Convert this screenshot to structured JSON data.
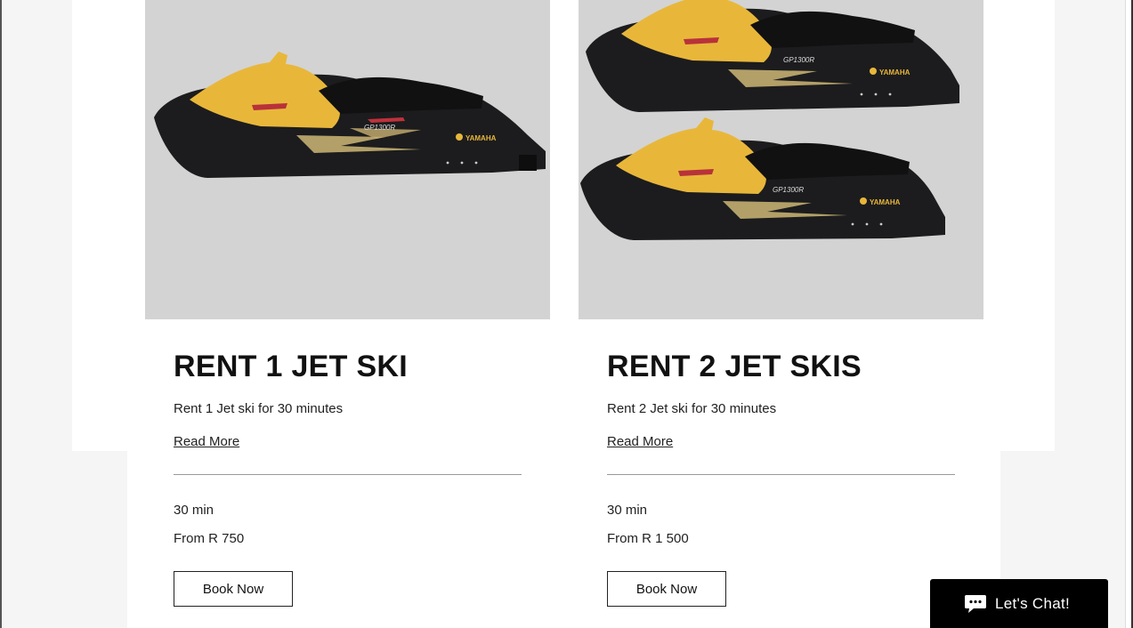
{
  "cards": [
    {
      "title": "RENT 1 JET SKI",
      "description": "Rent 1 Jet ski for 30 minutes",
      "read_more": "Read More",
      "duration": "30 min",
      "price": "From R 750",
      "book_label": "Book Now",
      "image_alt": "Yamaha jet ski",
      "brand_text": "YAMAHA",
      "model_text": "GP1300R"
    },
    {
      "title": "RENT 2 JET SKIS",
      "description": "Rent 2 Jet ski for 30 minutes",
      "read_more": "Read More",
      "duration": "30 min",
      "price": "From R 1 500",
      "book_label": "Book Now",
      "image_alt": "Two Yamaha jet skis",
      "brand_text": "YAMAHA",
      "model_text": "GP1300R"
    }
  ],
  "chat": {
    "label": "Let's Chat!",
    "icon": "chat-bubble-icon"
  },
  "colors": {
    "page_bg": "#f5f5f5",
    "card_bg": "#ffffff",
    "image_bg": "#d3d3d3",
    "jetski_gold": "#e8b73a",
    "jetski_black": "#1c1c1e",
    "chat_bg": "#000000"
  }
}
